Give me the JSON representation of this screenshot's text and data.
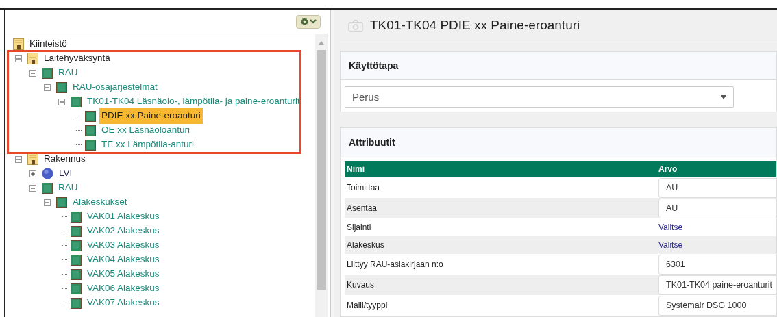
{
  "tree": [
    {
      "label": "Kiinteistö",
      "kind": "building",
      "selected": false,
      "children": [
        {
          "label": "Laitehyväksyntä",
          "kind": "building",
          "expanded": true,
          "selected": false,
          "highlighted": true,
          "children": [
            {
              "label": "RAU",
              "kind": "chip",
              "expanded": true,
              "selected": false,
              "children": [
                {
                  "label": "RAU-osajärjestelmät",
                  "kind": "chip",
                  "expanded": true,
                  "selected": false,
                  "children": [
                    {
                      "label": "TK01-TK04 Läsnäolo-, lämpötila- ja paine-eroanturit",
                      "kind": "chip",
                      "expanded": true,
                      "selected": false,
                      "children": [
                        {
                          "label": "PDIE xx Paine-eroanturi",
                          "kind": "chip",
                          "selected": true
                        },
                        {
                          "label": "OE xx Läsnäoloanturi",
                          "kind": "chip",
                          "selected": false
                        },
                        {
                          "label": "TE xx Lämpötila-anturi",
                          "kind": "chip",
                          "selected": false
                        }
                      ]
                    }
                  ]
                }
              ]
            }
          ]
        },
        {
          "label": "Rakennus",
          "kind": "building",
          "expanded": true,
          "selected": false,
          "children": [
            {
              "label": "LVI",
              "kind": "circle",
              "expanded": false,
              "selected": false
            },
            {
              "label": "RAU",
              "kind": "chip",
              "expanded": true,
              "selected": false,
              "children": [
                {
                  "label": "Alakeskukset",
                  "kind": "chip",
                  "expanded": true,
                  "selected": false,
                  "children": [
                    {
                      "label": "VAK01 Alakeskus",
                      "kind": "chip",
                      "selected": false
                    },
                    {
                      "label": "VAK02 Alakeskus",
                      "kind": "chip",
                      "selected": false
                    },
                    {
                      "label": "VAK03 Alakeskus",
                      "kind": "chip",
                      "selected": false
                    },
                    {
                      "label": "VAK04 Alakeskus",
                      "kind": "chip",
                      "selected": false
                    },
                    {
                      "label": "VAK05 Alakeskus",
                      "kind": "chip",
                      "selected": false
                    },
                    {
                      "label": "VAK06 Alakeskus",
                      "kind": "chip",
                      "selected": false
                    },
                    {
                      "label": "VAK07 Alakeskus",
                      "kind": "chip",
                      "selected": false
                    }
                  ]
                }
              ]
            }
          ]
        }
      ]
    }
  ],
  "detail": {
    "title": "TK01-TK04 PDIE xx Paine-eroanturi",
    "usage": {
      "heading": "Käyttötapa",
      "select_value": "Perus"
    },
    "attributes": {
      "heading": "Attribuutit",
      "columns": [
        "Nimi",
        "Arvo"
      ],
      "rows": [
        {
          "name": "Toimittaa",
          "kind": "input",
          "value": "AU"
        },
        {
          "name": "Asentaa",
          "kind": "input",
          "value": "AU"
        },
        {
          "name": "Sijainti",
          "kind": "link",
          "value": "Valitse"
        },
        {
          "name": "Alakeskus",
          "kind": "link",
          "value": "Valitse"
        },
        {
          "name": "Liittyy RAU-asiakirjaan n:o",
          "kind": "input",
          "value": "6301"
        },
        {
          "name": "Kuvaus",
          "kind": "input",
          "value": "TK01-TK04 paine-eroanturit"
        },
        {
          "name": "Malli/tyyppi",
          "kind": "input",
          "value": "Systemair DSG 1000"
        }
      ]
    }
  }
}
